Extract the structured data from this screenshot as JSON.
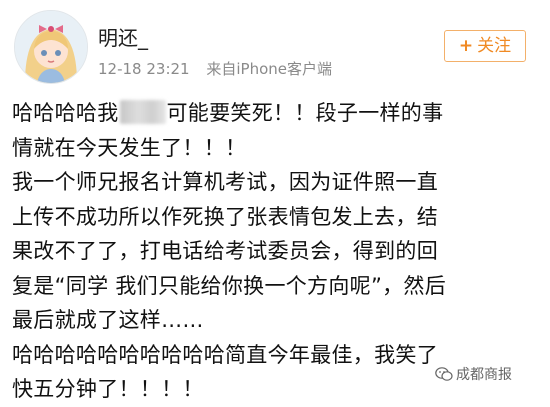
{
  "post": {
    "username": "明还_",
    "timestamp": "12-18 23:21",
    "source": "来自iPhone客户端",
    "follow_label": "关注",
    "follow_icon": "plus-icon",
    "avatar_icon": "anime-avatar-icon",
    "lines": [
      {
        "before": "哈哈哈哈我",
        "after": "可能要笑死！！段子一样的事"
      },
      "情就在今天发生了！！！",
      "我一个师兄报名计算机考试，因为证件照一直",
      "上传不成功所以作死换了张表情包发上去，结",
      "果改不了了，打电话给考试委员会，得到的回",
      "复是“同学 我们只能给你换一个方向呢”，然后",
      "最后就成了这样……",
      "哈哈哈哈哈哈哈哈哈哈简直今年最佳，我笑了",
      "快五分钟了！！！！"
    ]
  },
  "watermark": {
    "text": "成都商报",
    "icon": "wechat-icon"
  },
  "colors": {
    "accent": "#f08a24",
    "meta": "#8a8a8a"
  }
}
